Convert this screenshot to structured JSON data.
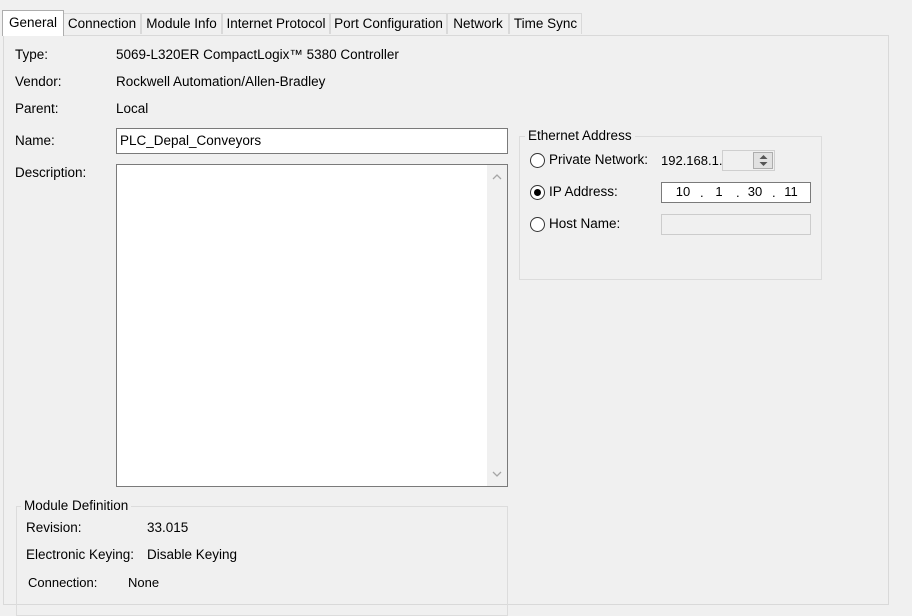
{
  "tabs": [
    {
      "label": "General"
    },
    {
      "label": "Connection"
    },
    {
      "label": "Module Info"
    },
    {
      "label": "Internet Protocol"
    },
    {
      "label": "Port Configuration"
    },
    {
      "label": "Network"
    },
    {
      "label": "Time Sync"
    }
  ],
  "general": {
    "type_label": "Type:",
    "type_value": "5069-L320ER CompactLogix™ 5380 Controller",
    "vendor_label": "Vendor:",
    "vendor_value": "Rockwell Automation/Allen-Bradley",
    "parent_label": "Parent:",
    "parent_value": "Local",
    "name_label": "Name:",
    "name_value": "PLC_Depal_Conveyors",
    "description_label": "Description:",
    "description_value": ""
  },
  "ethernet": {
    "group_title": "Ethernet Address",
    "private_label": "Private Network:",
    "private_prefix": "192.168.1.",
    "private_value": "",
    "ip_label": "IP Address:",
    "ip_octets": [
      "10",
      "1",
      "30",
      "11"
    ],
    "ip_dot": ".",
    "host_label": "Host Name:",
    "host_value": "",
    "selected": "ip"
  },
  "module_definition": {
    "group_title": "Module Definition",
    "revision_label": "Revision:",
    "revision_value": "33.015",
    "keying_label": "Electronic Keying:",
    "keying_value": "Disable Keying",
    "connection_label": "Connection:",
    "connection_value": "None"
  }
}
